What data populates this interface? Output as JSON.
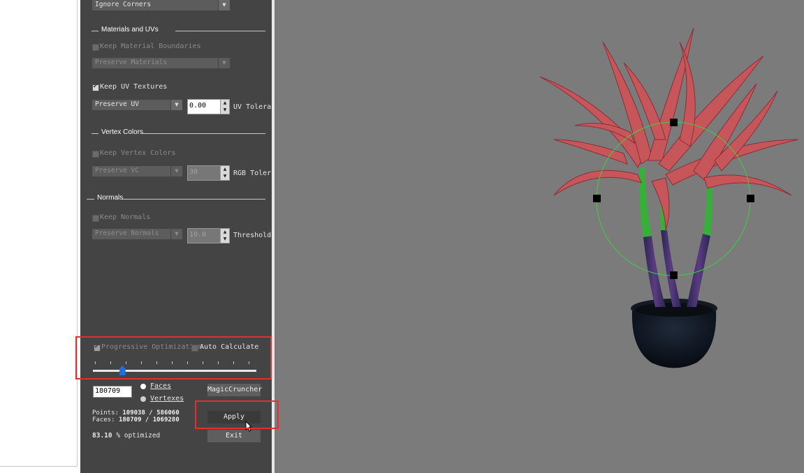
{
  "panel": {
    "ignore_corners": "Ignore Corners",
    "materials_group": "Materials and UVs",
    "keep_material_boundaries": "Keep Material Boundaries",
    "preserve_materials": "Preserve Materials",
    "keep_uv_textures": "Keep UV Textures",
    "preserve_uv": "Preserve UV",
    "uv_value": "0.00",
    "uv_tolerance": "UV Tolera",
    "vertex_colors_group": "Vertex Colors",
    "keep_vertex_colors": "Keep Vertex Colors",
    "preserve_vc": "Preserve VC",
    "rgb_value": "30",
    "rgb_tolerance": "RGB Toler",
    "normals_group": "Normals",
    "keep_normals": "Keep Normals",
    "preserve_normals": "Preserve Normals",
    "normals_value": "10.0",
    "threshold": "Threshold",
    "progressive_optimization": "Progressive Optimization",
    "auto_calculate": "Auto Calculate",
    "slider_level": 0.18,
    "face_count_value": "180709",
    "faces_option": "Faces",
    "vertexes_option": "Vertexes",
    "magic_cruncher": "MagicCruncher",
    "points_label": "Points:",
    "points_value": "109038 / 586060",
    "faces_label": "Faces:",
    "faces_value": "180709 / 1069280",
    "optimized_percent": "83.10",
    "optimized_label": "% optimized",
    "apply": "Apply",
    "exit": "Exit"
  },
  "colors": {
    "panel_bg": "#444444",
    "viewport_bg": "#7b7b7b",
    "highlight": "#e03030",
    "slider_thumb": "#1e6fe0",
    "gizmo_green": "#3fcf3f"
  }
}
